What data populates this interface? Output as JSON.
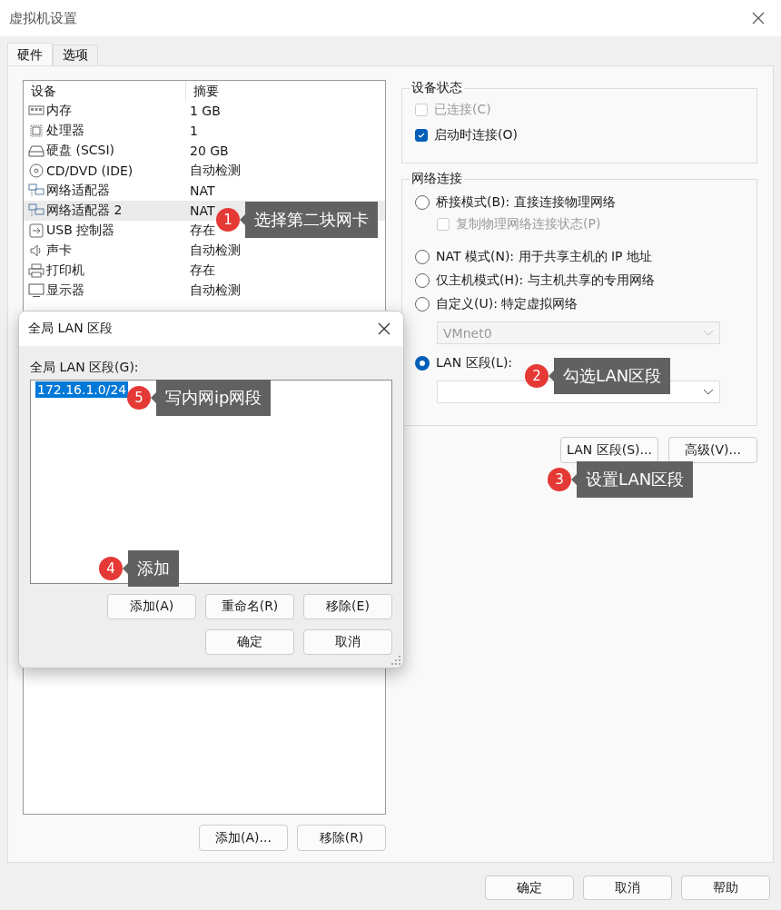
{
  "window": {
    "title": "虚拟机设置"
  },
  "tabs": [
    {
      "label": "硬件",
      "selected": true
    },
    {
      "label": "选项",
      "selected": false
    }
  ],
  "devices": {
    "columns": [
      "设备",
      "摘要"
    ],
    "rows": [
      {
        "kind": "memory",
        "name": "内存",
        "summary": "1 GB",
        "selected": false
      },
      {
        "kind": "cpu",
        "name": "处理器",
        "summary": "1",
        "selected": false
      },
      {
        "kind": "disk",
        "name": "硬盘 (SCSI)",
        "summary": "20 GB",
        "selected": false
      },
      {
        "kind": "cdrom",
        "name": "CD/DVD (IDE)",
        "summary": "自动检测",
        "selected": false
      },
      {
        "kind": "network",
        "name": "网络适配器",
        "summary": "NAT",
        "selected": false
      },
      {
        "kind": "network",
        "name": "网络适配器 2",
        "summary": "NAT",
        "selected": true
      },
      {
        "kind": "usb",
        "name": "USB 控制器",
        "summary": "存在",
        "selected": false
      },
      {
        "kind": "sound",
        "name": "声卡",
        "summary": "自动检测",
        "selected": false
      },
      {
        "kind": "printer",
        "name": "打印机",
        "summary": "存在",
        "selected": false
      },
      {
        "kind": "display",
        "name": "显示器",
        "summary": "自动检测",
        "selected": false
      }
    ]
  },
  "device_buttons": [
    "添加(A)...",
    "移除(R)"
  ],
  "device_status": {
    "title": "设备状态",
    "options": [
      {
        "label": "已连接(C)",
        "checked": false,
        "disabled": true
      },
      {
        "label": "启动时连接(O)",
        "checked": true,
        "disabled": false
      }
    ]
  },
  "network": {
    "title": "网络连接",
    "options": [
      {
        "kind": "radio",
        "label": "桥接模式(B): 直接连接物理网络",
        "selected": false
      },
      {
        "kind": "checkbox",
        "label": "复制物理网络连接状态(P)",
        "checked": false,
        "disabled": true
      },
      {
        "kind": "radio",
        "label": "NAT 模式(N): 用于共享主机的 IP 地址",
        "selected": false
      },
      {
        "kind": "radio",
        "label": "仅主机模式(H): 与主机共享的专用网络",
        "selected": false
      },
      {
        "kind": "radio",
        "label": "自定义(U): 特定虚拟网络",
        "selected": false
      },
      {
        "kind": "dropdown",
        "value": "VMnet0",
        "disabled": true
      },
      {
        "kind": "radio",
        "label": "LAN 区段(L):",
        "selected": true
      },
      {
        "kind": "dropdown",
        "disabled": false
      }
    ]
  },
  "network_buttons": [
    "LAN 区段(S)...",
    "高级(V)..."
  ],
  "footer_buttons": [
    "确定",
    "取消",
    "帮助"
  ],
  "dialog": {
    "title": "全局 LAN 区段",
    "list_label": "全局 LAN 区段(G):",
    "items": [
      {
        "label": "172.16.1.0/24",
        "selected": true
      }
    ],
    "buttons": [
      "添加(A)",
      "重命名(R)",
      "移除(E)"
    ],
    "footer_buttons": [
      "确定",
      "取消"
    ]
  },
  "annotations": [
    {
      "number": "1",
      "text": "选择第二块网卡"
    },
    {
      "number": "2",
      "text": "勾选LAN区段"
    },
    {
      "number": "3",
      "text": "设置LAN区段"
    },
    {
      "number": "4",
      "text": "添加"
    },
    {
      "number": "5",
      "text": "写内网ip网段"
    }
  ]
}
